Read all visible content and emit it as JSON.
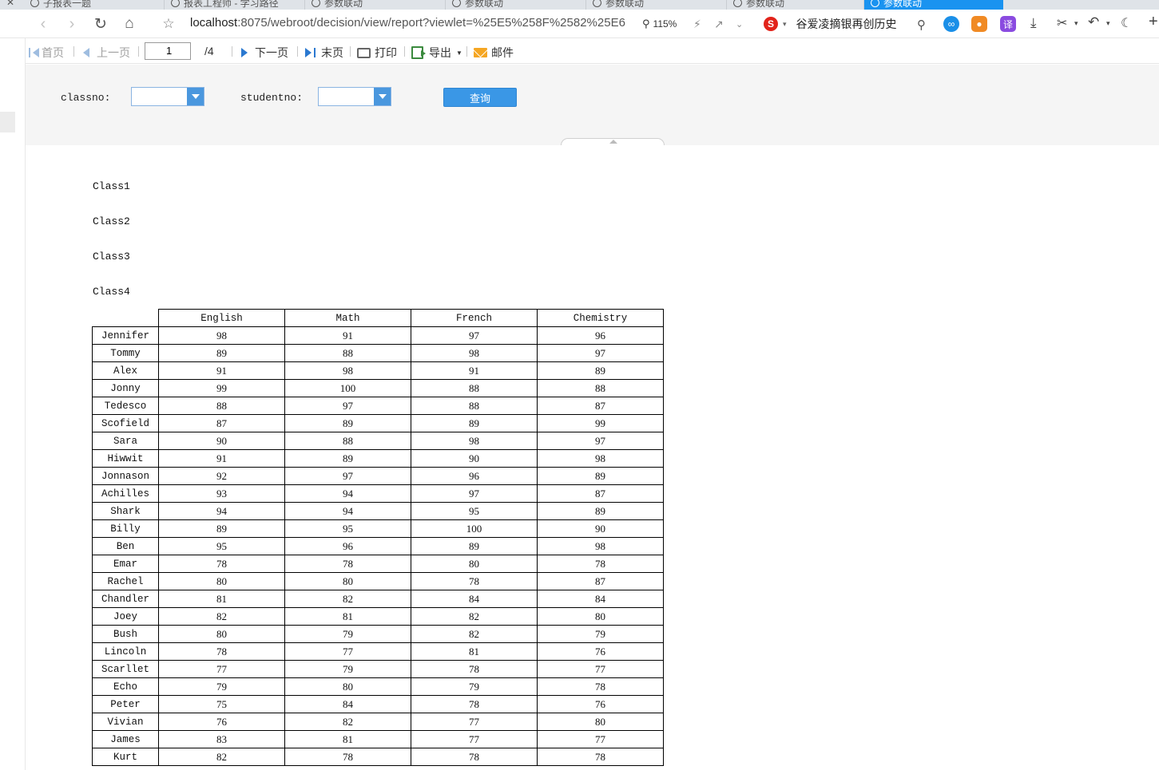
{
  "browser": {
    "tabs": [
      {
        "label": "子报表一题",
        "active": false
      },
      {
        "label": "报表工程师 - 学习路径",
        "active": false
      },
      {
        "label": "参数联动",
        "active": false
      },
      {
        "label": "参数联动",
        "active": false
      },
      {
        "label": "参数联动",
        "active": false
      },
      {
        "label": "参数联动",
        "active": false
      },
      {
        "label": "参数联动",
        "active": true
      }
    ],
    "url_host": "localhost",
    "url_rest": ":8075/webroot/decision/view/report?viewlet=%25E5%258F%2582%25E6'",
    "zoom": "115%",
    "search_text": "谷爱凌摘银再创历史",
    "translate_label": "译",
    "accent_color": "#1a93f0"
  },
  "toolbar": {
    "first_page": "首页",
    "prev_page": "上一页",
    "current_page": "1",
    "total_pages": "/4",
    "next_page": "下一页",
    "last_page": "末页",
    "print": "打印",
    "export": "导出",
    "mail": "邮件"
  },
  "params": {
    "classno_label": "classno:",
    "studentno_label": "studentno:",
    "query_button": "查询",
    "button_color": "#3a97e6"
  },
  "report": {
    "classes": [
      "Class1",
      "Class2",
      "Class3",
      "Class4"
    ],
    "columns": [
      "English",
      "Math",
      "French",
      "Chemistry"
    ],
    "rows": [
      {
        "name": "Jennifer",
        "values": [
          "98",
          "91",
          "97",
          "96"
        ]
      },
      {
        "name": "Tommy",
        "values": [
          "89",
          "88",
          "98",
          "97"
        ]
      },
      {
        "name": "Alex",
        "values": [
          "91",
          "98",
          "91",
          "89"
        ]
      },
      {
        "name": "Jonny",
        "values": [
          "99",
          "100",
          "88",
          "88"
        ]
      },
      {
        "name": "Tedesco",
        "values": [
          "88",
          "97",
          "88",
          "87"
        ]
      },
      {
        "name": "Scofield",
        "values": [
          "87",
          "89",
          "89",
          "99"
        ]
      },
      {
        "name": "Sara",
        "values": [
          "90",
          "88",
          "98",
          "97"
        ]
      },
      {
        "name": "Hiwwit",
        "values": [
          "91",
          "89",
          "90",
          "98"
        ]
      },
      {
        "name": "Jonnason",
        "values": [
          "92",
          "97",
          "96",
          "89"
        ]
      },
      {
        "name": "Achilles",
        "values": [
          "93",
          "94",
          "97",
          "87"
        ]
      },
      {
        "name": "Shark",
        "values": [
          "94",
          "94",
          "95",
          "89"
        ]
      },
      {
        "name": "Billy",
        "values": [
          "89",
          "95",
          "100",
          "90"
        ]
      },
      {
        "name": "Ben",
        "values": [
          "95",
          "96",
          "89",
          "98"
        ]
      },
      {
        "name": "Emar",
        "values": [
          "78",
          "78",
          "80",
          "78"
        ]
      },
      {
        "name": "Rachel",
        "values": [
          "80",
          "80",
          "78",
          "87"
        ]
      },
      {
        "name": "Chandler",
        "values": [
          "81",
          "82",
          "84",
          "84"
        ]
      },
      {
        "name": "Joey",
        "values": [
          "82",
          "81",
          "82",
          "80"
        ]
      },
      {
        "name": "Bush",
        "values": [
          "80",
          "79",
          "82",
          "79"
        ]
      },
      {
        "name": "Lincoln",
        "values": [
          "78",
          "77",
          "81",
          "76"
        ]
      },
      {
        "name": "Scarllet",
        "values": [
          "77",
          "79",
          "78",
          "77"
        ]
      },
      {
        "name": "Echo",
        "values": [
          "79",
          "80",
          "79",
          "78"
        ]
      },
      {
        "name": "Peter",
        "values": [
          "75",
          "84",
          "78",
          "76"
        ]
      },
      {
        "name": "Vivian",
        "values": [
          "76",
          "82",
          "77",
          "80"
        ]
      },
      {
        "name": "James",
        "values": [
          "83",
          "81",
          "77",
          "77"
        ]
      },
      {
        "name": "Kurt",
        "values": [
          "82",
          "78",
          "78",
          "78"
        ]
      }
    ]
  }
}
